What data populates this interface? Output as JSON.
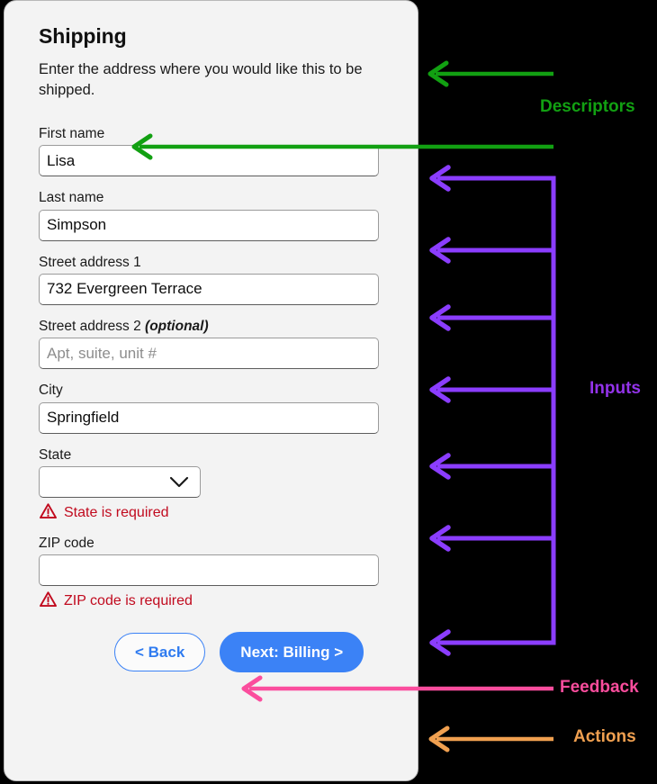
{
  "card": {
    "title": "Shipping",
    "subtitle": "Enter the address where you would like this to be shipped."
  },
  "form": {
    "fields": [
      {
        "id": "first-name",
        "label": "First name",
        "optional_suffix": "",
        "value": "Lisa",
        "placeholder": "",
        "type": "text"
      },
      {
        "id": "last-name",
        "label": "Last name",
        "optional_suffix": "",
        "value": "Simpson",
        "placeholder": "",
        "type": "text"
      },
      {
        "id": "street-address-1",
        "label": "Street address 1",
        "optional_suffix": "",
        "value": "732 Evergreen Terrace",
        "placeholder": "",
        "type": "text"
      },
      {
        "id": "street-address-2",
        "label": "Street address 2",
        "optional_suffix": "(optional)",
        "value": "",
        "placeholder": "Apt, suite, unit #",
        "type": "text"
      },
      {
        "id": "city",
        "label": "City",
        "optional_suffix": "",
        "value": "Springfield",
        "placeholder": "",
        "type": "text"
      },
      {
        "id": "state",
        "label": "State",
        "optional_suffix": "",
        "value": "",
        "placeholder": "",
        "type": "select",
        "error": "State is required"
      },
      {
        "id": "zip-code",
        "label": "ZIP code",
        "optional_suffix": "",
        "value": "",
        "placeholder": "",
        "type": "text",
        "error": "ZIP code is required"
      }
    ],
    "errors": {
      "state": "State is required",
      "zip": "ZIP code is required"
    }
  },
  "actions": {
    "back_label": "< Back",
    "next_label": "Next: Billing >"
  },
  "annotations": {
    "descriptors": {
      "label": "Descriptors",
      "color": "#12a012"
    },
    "inputs": {
      "label": "Inputs",
      "color": "#9333ea"
    },
    "feedback": {
      "label": "Feedback",
      "color": "#fb4d9d"
    },
    "actions": {
      "label": "Actions",
      "color": "#f0a050"
    }
  },
  "icons": {
    "warning": "warning-triangle-icon",
    "chevron": "chevron-down-icon"
  }
}
